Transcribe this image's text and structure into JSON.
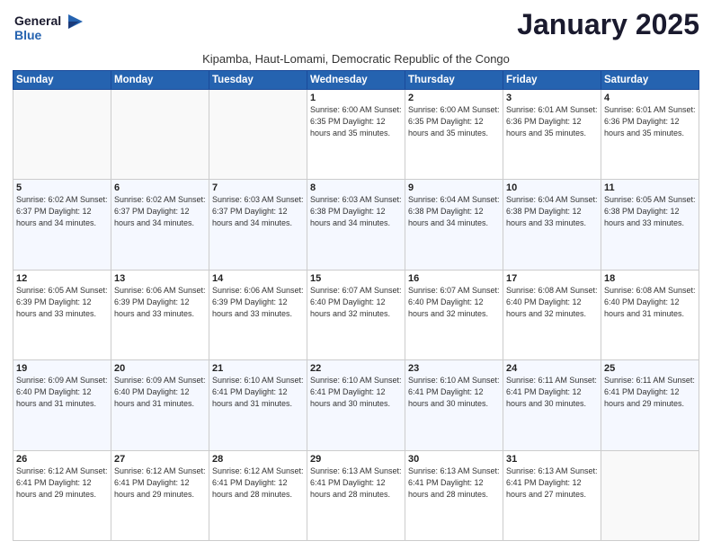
{
  "logo": {
    "line1": "General",
    "line2": "Blue"
  },
  "title": "January 2025",
  "subtitle": "Kipamba, Haut-Lomami, Democratic Republic of the Congo",
  "header_days": [
    "Sunday",
    "Monday",
    "Tuesday",
    "Wednesday",
    "Thursday",
    "Friday",
    "Saturday"
  ],
  "weeks": [
    [
      {
        "day": "",
        "info": ""
      },
      {
        "day": "",
        "info": ""
      },
      {
        "day": "",
        "info": ""
      },
      {
        "day": "1",
        "info": "Sunrise: 6:00 AM\nSunset: 6:35 PM\nDaylight: 12 hours\nand 35 minutes."
      },
      {
        "day": "2",
        "info": "Sunrise: 6:00 AM\nSunset: 6:35 PM\nDaylight: 12 hours\nand 35 minutes."
      },
      {
        "day": "3",
        "info": "Sunrise: 6:01 AM\nSunset: 6:36 PM\nDaylight: 12 hours\nand 35 minutes."
      },
      {
        "day": "4",
        "info": "Sunrise: 6:01 AM\nSunset: 6:36 PM\nDaylight: 12 hours\nand 35 minutes."
      }
    ],
    [
      {
        "day": "5",
        "info": "Sunrise: 6:02 AM\nSunset: 6:37 PM\nDaylight: 12 hours\nand 34 minutes."
      },
      {
        "day": "6",
        "info": "Sunrise: 6:02 AM\nSunset: 6:37 PM\nDaylight: 12 hours\nand 34 minutes."
      },
      {
        "day": "7",
        "info": "Sunrise: 6:03 AM\nSunset: 6:37 PM\nDaylight: 12 hours\nand 34 minutes."
      },
      {
        "day": "8",
        "info": "Sunrise: 6:03 AM\nSunset: 6:38 PM\nDaylight: 12 hours\nand 34 minutes."
      },
      {
        "day": "9",
        "info": "Sunrise: 6:04 AM\nSunset: 6:38 PM\nDaylight: 12 hours\nand 34 minutes."
      },
      {
        "day": "10",
        "info": "Sunrise: 6:04 AM\nSunset: 6:38 PM\nDaylight: 12 hours\nand 33 minutes."
      },
      {
        "day": "11",
        "info": "Sunrise: 6:05 AM\nSunset: 6:38 PM\nDaylight: 12 hours\nand 33 minutes."
      }
    ],
    [
      {
        "day": "12",
        "info": "Sunrise: 6:05 AM\nSunset: 6:39 PM\nDaylight: 12 hours\nand 33 minutes."
      },
      {
        "day": "13",
        "info": "Sunrise: 6:06 AM\nSunset: 6:39 PM\nDaylight: 12 hours\nand 33 minutes."
      },
      {
        "day": "14",
        "info": "Sunrise: 6:06 AM\nSunset: 6:39 PM\nDaylight: 12 hours\nand 33 minutes."
      },
      {
        "day": "15",
        "info": "Sunrise: 6:07 AM\nSunset: 6:40 PM\nDaylight: 12 hours\nand 32 minutes."
      },
      {
        "day": "16",
        "info": "Sunrise: 6:07 AM\nSunset: 6:40 PM\nDaylight: 12 hours\nand 32 minutes."
      },
      {
        "day": "17",
        "info": "Sunrise: 6:08 AM\nSunset: 6:40 PM\nDaylight: 12 hours\nand 32 minutes."
      },
      {
        "day": "18",
        "info": "Sunrise: 6:08 AM\nSunset: 6:40 PM\nDaylight: 12 hours\nand 31 minutes."
      }
    ],
    [
      {
        "day": "19",
        "info": "Sunrise: 6:09 AM\nSunset: 6:40 PM\nDaylight: 12 hours\nand 31 minutes."
      },
      {
        "day": "20",
        "info": "Sunrise: 6:09 AM\nSunset: 6:40 PM\nDaylight: 12 hours\nand 31 minutes."
      },
      {
        "day": "21",
        "info": "Sunrise: 6:10 AM\nSunset: 6:41 PM\nDaylight: 12 hours\nand 31 minutes."
      },
      {
        "day": "22",
        "info": "Sunrise: 6:10 AM\nSunset: 6:41 PM\nDaylight: 12 hours\nand 30 minutes."
      },
      {
        "day": "23",
        "info": "Sunrise: 6:10 AM\nSunset: 6:41 PM\nDaylight: 12 hours\nand 30 minutes."
      },
      {
        "day": "24",
        "info": "Sunrise: 6:11 AM\nSunset: 6:41 PM\nDaylight: 12 hours\nand 30 minutes."
      },
      {
        "day": "25",
        "info": "Sunrise: 6:11 AM\nSunset: 6:41 PM\nDaylight: 12 hours\nand 29 minutes."
      }
    ],
    [
      {
        "day": "26",
        "info": "Sunrise: 6:12 AM\nSunset: 6:41 PM\nDaylight: 12 hours\nand 29 minutes."
      },
      {
        "day": "27",
        "info": "Sunrise: 6:12 AM\nSunset: 6:41 PM\nDaylight: 12 hours\nand 29 minutes."
      },
      {
        "day": "28",
        "info": "Sunrise: 6:12 AM\nSunset: 6:41 PM\nDaylight: 12 hours\nand 28 minutes."
      },
      {
        "day": "29",
        "info": "Sunrise: 6:13 AM\nSunset: 6:41 PM\nDaylight: 12 hours\nand 28 minutes."
      },
      {
        "day": "30",
        "info": "Sunrise: 6:13 AM\nSunset: 6:41 PM\nDaylight: 12 hours\nand 28 minutes."
      },
      {
        "day": "31",
        "info": "Sunrise: 6:13 AM\nSunset: 6:41 PM\nDaylight: 12 hours\nand 27 minutes."
      },
      {
        "day": "",
        "info": ""
      }
    ]
  ]
}
